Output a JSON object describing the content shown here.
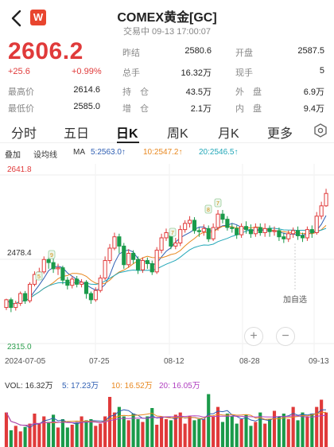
{
  "header": {
    "title": "COMEX黄金[GC]",
    "subtitle": "交易中 09-13 17:00:07",
    "brand_letter": "W"
  },
  "quote": {
    "price": "2606.2",
    "change": "+25.6",
    "change_pct": "+0.99%",
    "stats": [
      {
        "label": "昨结",
        "value": "2580.6"
      },
      {
        "label": "开盘",
        "value": "2587.5"
      },
      {
        "label": "总手",
        "value": "16.32万"
      },
      {
        "label": "现手",
        "value": "5"
      },
      {
        "label": "最高价",
        "value": "2614.6"
      },
      {
        "label": "持　仓",
        "value": "43.5万"
      },
      {
        "label": "外　盘",
        "value": "6.9万"
      },
      {
        "label": "最低价",
        "value": "2585.0"
      },
      {
        "label": "增　仓",
        "value": "2.1万"
      },
      {
        "label": "内　盘",
        "value": "9.4万"
      }
    ]
  },
  "tabs": [
    "分时",
    "五日",
    "日K",
    "周K",
    "月K",
    "更多"
  ],
  "toolbar": {
    "overlay": "叠加",
    "drawline": "设均线",
    "ma": "MA",
    "ma5": "5:2563.0↑",
    "ma10": "10:2547.2↑",
    "ma20": "20:2546.5↑"
  },
  "chart": {
    "y_high": "2641.8",
    "y_mid": "2478.4",
    "y_low": "2315.0",
    "watch": "加自选",
    "dates": [
      "2024-07-05",
      "07-25",
      "08-12",
      "08-28",
      "09-13"
    ],
    "markers": [
      "5",
      "9",
      "7",
      "7",
      "8"
    ]
  },
  "volume": {
    "vol": "VOL: 16.32万",
    "v5": "5: 17.23万",
    "v10": "10: 16.52万",
    "v20": "20: 16.05万"
  },
  "colors": {
    "up": "#e03a3a",
    "down": "#1a9a4a",
    "ma5": "#2f5fb3",
    "ma10": "#e8871e",
    "ma20": "#22a7b8",
    "v20": "#b040c0"
  },
  "chart_data": {
    "type": "candlestick",
    "ylim": [
      2315.0,
      2641.8
    ],
    "candles": [
      [
        2385,
        2400,
        2380,
        2402
      ],
      [
        2400,
        2385,
        2376,
        2404
      ],
      [
        2385,
        2393,
        2379,
        2398
      ],
      [
        2393,
        2412,
        2388,
        2416
      ],
      [
        2412,
        2398,
        2392,
        2417
      ],
      [
        2398,
        2430,
        2394,
        2434
      ],
      [
        2430,
        2449,
        2426,
        2455
      ],
      [
        2449,
        2454,
        2442,
        2462
      ],
      [
        2454,
        2478,
        2450,
        2484
      ],
      [
        2478,
        2472,
        2460,
        2485
      ],
      [
        2472,
        2460,
        2452,
        2480
      ],
      [
        2460,
        2462,
        2448,
        2470
      ],
      [
        2462,
        2438,
        2430,
        2466
      ],
      [
        2438,
        2428,
        2420,
        2444
      ],
      [
        2428,
        2440,
        2422,
        2446
      ],
      [
        2440,
        2430,
        2424,
        2446
      ],
      [
        2430,
        2434,
        2424,
        2440
      ],
      [
        2434,
        2412,
        2402,
        2438
      ],
      [
        2412,
        2400,
        2392,
        2416
      ],
      [
        2400,
        2418,
        2396,
        2424
      ],
      [
        2418,
        2442,
        2414,
        2448
      ],
      [
        2442,
        2476,
        2438,
        2484
      ],
      [
        2476,
        2500,
        2470,
        2508
      ],
      [
        2500,
        2522,
        2496,
        2530
      ],
      [
        2522,
        2504,
        2490,
        2528
      ],
      [
        2504,
        2468,
        2460,
        2510
      ],
      [
        2468,
        2490,
        2462,
        2498
      ],
      [
        2490,
        2478,
        2470,
        2496
      ],
      [
        2478,
        2458,
        2450,
        2484
      ],
      [
        2458,
        2476,
        2452,
        2482
      ],
      [
        2476,
        2470,
        2460,
        2482
      ],
      [
        2470,
        2454,
        2448,
        2476
      ],
      [
        2454,
        2496,
        2450,
        2502
      ],
      [
        2496,
        2520,
        2490,
        2528
      ],
      [
        2520,
        2530,
        2514,
        2538
      ],
      [
        2530,
        2504,
        2498,
        2534
      ],
      [
        2504,
        2510,
        2498,
        2520
      ],
      [
        2510,
        2536,
        2504,
        2544
      ],
      [
        2536,
        2548,
        2530,
        2554
      ],
      [
        2548,
        2554,
        2540,
        2562
      ],
      [
        2554,
        2534,
        2528,
        2560
      ],
      [
        2534,
        2532,
        2522,
        2540
      ],
      [
        2532,
        2538,
        2524,
        2546
      ],
      [
        2538,
        2518,
        2512,
        2544
      ],
      [
        2518,
        2540,
        2514,
        2548
      ],
      [
        2540,
        2566,
        2534,
        2574
      ],
      [
        2566,
        2556,
        2548,
        2574
      ],
      [
        2556,
        2540,
        2534,
        2562
      ],
      [
        2540,
        2538,
        2530,
        2548
      ],
      [
        2538,
        2526,
        2518,
        2544
      ],
      [
        2526,
        2542,
        2520,
        2548
      ],
      [
        2542,
        2536,
        2528,
        2552
      ],
      [
        2536,
        2528,
        2520,
        2546
      ],
      [
        2528,
        2540,
        2522,
        2548
      ],
      [
        2540,
        2530,
        2524,
        2548
      ],
      [
        2530,
        2538,
        2522,
        2548
      ],
      [
        2538,
        2532,
        2522,
        2544
      ],
      [
        2532,
        2534,
        2524,
        2542
      ],
      [
        2534,
        2522,
        2514,
        2540
      ],
      [
        2522,
        2518,
        2510,
        2530
      ],
      [
        2518,
        2528,
        2512,
        2534
      ],
      [
        2528,
        2534,
        2520,
        2540
      ],
      [
        2534,
        2524,
        2516,
        2542
      ],
      [
        2524,
        2520,
        2512,
        2530
      ],
      [
        2520,
        2536,
        2514,
        2542
      ],
      [
        2536,
        2530,
        2520,
        2544
      ],
      [
        2530,
        2562,
        2526,
        2570
      ],
      [
        2562,
        2582,
        2556,
        2590
      ],
      [
        2582,
        2606,
        2580,
        2615
      ]
    ],
    "volumes": [
      0.62,
      0.3,
      0.38,
      0.28,
      0.36,
      0.42,
      0.6,
      0.42,
      0.55,
      0.45,
      0.58,
      0.35,
      0.5,
      0.35,
      0.4,
      0.45,
      0.55,
      0.48,
      0.5,
      0.38,
      0.42,
      0.55,
      0.9,
      0.62,
      0.72,
      0.55,
      0.48,
      0.6,
      0.5,
      0.45,
      0.55,
      0.7,
      0.4,
      0.55,
      0.5,
      0.48,
      0.58,
      0.62,
      0.42,
      0.55,
      0.48,
      0.5,
      0.5,
      0.95,
      0.55,
      0.72,
      0.45,
      0.6,
      0.55,
      0.42,
      0.5,
      0.58,
      0.38,
      0.45,
      0.62,
      0.42,
      0.5,
      0.65,
      0.55,
      0.6,
      0.5,
      0.72,
      0.48,
      0.62,
      0.55,
      0.6,
      0.72,
      0.85,
      0.62
    ]
  }
}
